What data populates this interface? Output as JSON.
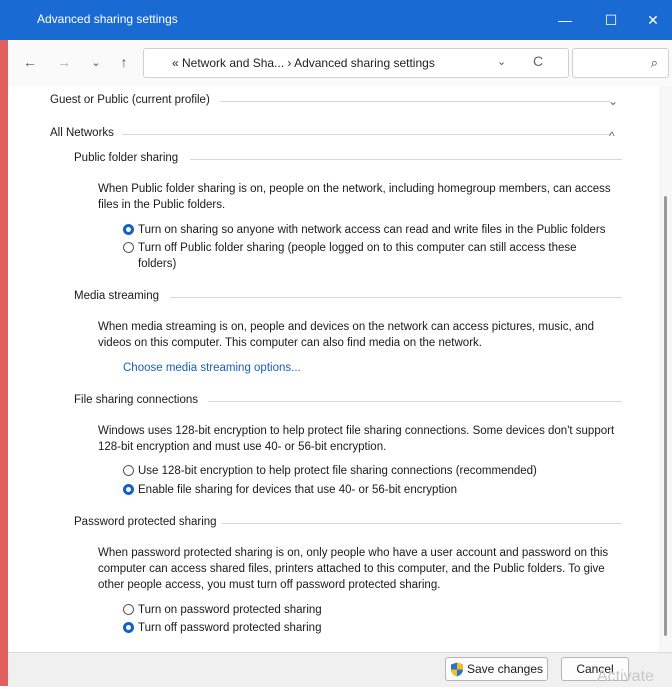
{
  "window": {
    "title": "Advanced sharing settings",
    "minimize": "—",
    "maximize": "☐",
    "close": "✕"
  },
  "nav": {
    "back": "←",
    "forward": "→",
    "recent": "⌄",
    "up": "↑"
  },
  "address": {
    "crumbs": "« Network and Sha...  ›  Advanced sharing settings",
    "dropdown": "⌄",
    "refresh": "C"
  },
  "search": {
    "placeholder": "",
    "icon": "⌕"
  },
  "sections": {
    "guest": {
      "label": "Guest or Public (current profile)",
      "chevron": "⌄"
    },
    "all": {
      "label": "All Networks",
      "chevron": "^"
    }
  },
  "public_folder": {
    "heading": "Public folder sharing",
    "description": "When Public folder sharing is on, people on the network, including homegroup members, can access files in the Public folders.",
    "options": [
      {
        "label": "Turn on sharing so anyone with network access can read and write files in the Public folders",
        "checked": true
      },
      {
        "label": "Turn off Public folder sharing (people logged on to this computer can still access these folders)",
        "checked": false
      }
    ]
  },
  "media": {
    "heading": "Media streaming",
    "description": "When media streaming is on, people and devices on the network can access pictures, music, and videos on this computer. This computer can also find media on the network.",
    "link": "Choose media streaming options..."
  },
  "file_sharing": {
    "heading": "File sharing connections",
    "description": "Windows uses 128-bit encryption to help protect file sharing connections. Some devices don't support 128-bit encryption and must use 40- or 56-bit encryption.",
    "options": [
      {
        "label": "Use 128-bit encryption to help protect file sharing connections (recommended)",
        "checked": false
      },
      {
        "label": "Enable file sharing for devices that use 40- or 56-bit encryption",
        "checked": true
      }
    ]
  },
  "password": {
    "heading": "Password protected sharing",
    "description": "When password protected sharing is on, only people who have a user account and password on this computer can access shared files, printers attached to this computer, and the Public folders. To give other people access, you must turn off password protected sharing.",
    "options": [
      {
        "label": "Turn on password protected sharing",
        "checked": false
      },
      {
        "label": "Turn off password protected sharing",
        "checked": true
      }
    ]
  },
  "footer": {
    "save": "Save changes",
    "cancel": "Cancel",
    "watermark": "Activate"
  },
  "colors": {
    "accent": "#1a6ad4",
    "link": "#1560c0",
    "radio_checked": "#1160c8"
  }
}
